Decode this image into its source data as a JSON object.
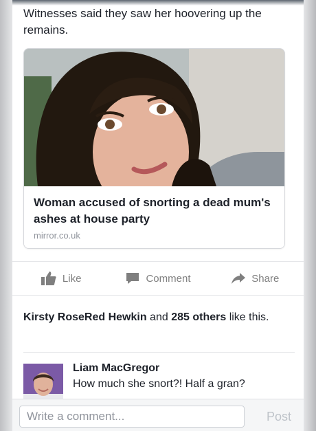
{
  "post": {
    "text": "Witnesses said they saw her hoovering up the remains."
  },
  "link_preview": {
    "title": "Woman accused of snorting a dead mum's ashes at house party",
    "domain": "mirror.co.uk"
  },
  "actions": {
    "like": "Like",
    "comment": "Comment",
    "share": "Share"
  },
  "likes": {
    "name": "Kirsty RoseRed Hewkin",
    "connector": " and ",
    "others": "285 others",
    "suffix": " like this."
  },
  "comment": {
    "author": "Liam MacGregor",
    "text": "How much she snort?! Half a gran?"
  },
  "composer": {
    "placeholder": "Write a comment...",
    "post_label": "Post"
  },
  "colors": {
    "icon_gray": "#7f7f7f",
    "text": "#1d2129",
    "muted": "#90949c"
  }
}
